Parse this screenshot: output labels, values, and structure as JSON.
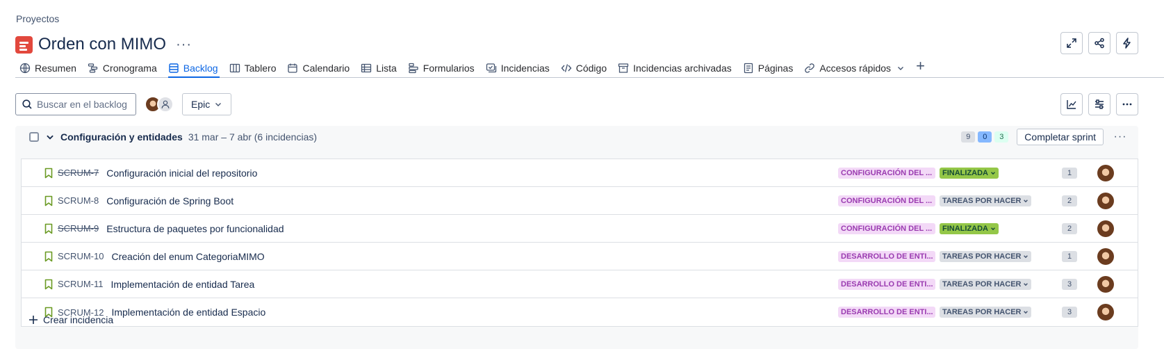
{
  "breadcrumb": "Proyectos",
  "project": {
    "title": "Orden con MIMO",
    "more": "···"
  },
  "tabs": [
    {
      "label": "Resumen",
      "icon": "globe-icon"
    },
    {
      "label": "Cronograma",
      "icon": "timeline-icon"
    },
    {
      "label": "Backlog",
      "icon": "backlog-icon",
      "active": true
    },
    {
      "label": "Tablero",
      "icon": "board-icon"
    },
    {
      "label": "Calendario",
      "icon": "calendar-icon"
    },
    {
      "label": "Lista",
      "icon": "list-icon"
    },
    {
      "label": "Formularios",
      "icon": "forms-icon"
    },
    {
      "label": "Incidencias",
      "icon": "issues-icon"
    },
    {
      "label": "Código",
      "icon": "code-icon"
    },
    {
      "label": "Incidencias archivadas",
      "icon": "archive-icon"
    },
    {
      "label": "Páginas",
      "icon": "pages-icon"
    },
    {
      "label": "Accesos rápidos",
      "icon": "link-icon"
    }
  ],
  "tab_add": "+",
  "search": {
    "placeholder": "Buscar en el backlog"
  },
  "epic_filter": "Epic",
  "sprint": {
    "name": "Configuración y entidades",
    "meta": "31 mar – 7 abr (6 incidencias)",
    "counts": {
      "todo": "9",
      "in_progress": "0",
      "done": "3"
    },
    "complete_label": "Completar sprint",
    "more": "···"
  },
  "issues": [
    {
      "key": "SCRUM-7",
      "summary": "Configuración inicial del repositorio",
      "epic": "CONFIGURACIÓN DEL ...",
      "status": "FINALIZADA",
      "done": true,
      "estimate": "1"
    },
    {
      "key": "SCRUM-8",
      "summary": "Configuración de Spring Boot",
      "epic": "CONFIGURACIÓN DEL ...",
      "status": "TAREAS POR HACER",
      "done": false,
      "estimate": "2"
    },
    {
      "key": "SCRUM-9",
      "summary": "Estructura de paquetes por funcionalidad",
      "epic": "CONFIGURACIÓN DEL ...",
      "status": "FINALIZADA",
      "done": true,
      "estimate": "2"
    },
    {
      "key": "SCRUM-10",
      "summary": "Creación del enum CategoriaMIMO",
      "epic": "DESARROLLO DE ENTI...",
      "status": "TAREAS POR HACER",
      "done": false,
      "estimate": "1"
    },
    {
      "key": "SCRUM-11",
      "summary": "Implementación de entidad Tarea",
      "epic": "DESARROLLO DE ENTI...",
      "status": "TAREAS POR HACER",
      "done": false,
      "estimate": "3"
    },
    {
      "key": "SCRUM-12",
      "summary": "Implementación de entidad Espacio",
      "epic": "DESARROLLO DE ENTI...",
      "status": "TAREAS POR HACER",
      "done": false,
      "estimate": "3"
    }
  ],
  "create_issue": "Crear incidencia",
  "colors": {
    "accent": "#0c66e4",
    "project_icon": "#e2483d",
    "epic_bg": "#f3d9f7",
    "epic_text": "#9a3bb0",
    "done_bg": "#94c748"
  }
}
